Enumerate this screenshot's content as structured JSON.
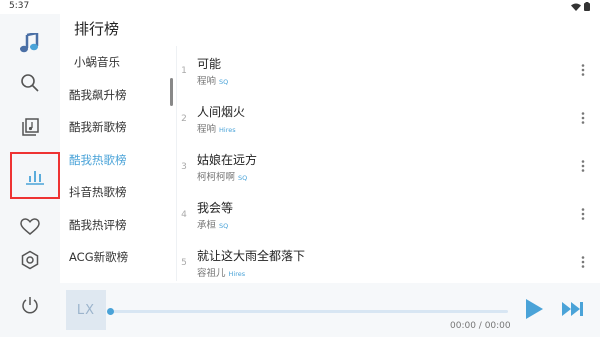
{
  "status": {
    "time": "5:37",
    "icons": [
      "wifi-icon",
      "battery-icon"
    ]
  },
  "nav": {
    "items": [
      {
        "name": "music-note-logo-icon"
      },
      {
        "name": "search-icon"
      },
      {
        "name": "song-list-icon"
      },
      {
        "name": "leaderboard-icon",
        "active": true
      },
      {
        "name": "heart-icon"
      },
      {
        "name": "settings-hexagon-icon"
      },
      {
        "name": "power-icon"
      }
    ]
  },
  "page": {
    "title": "排行榜"
  },
  "boards": {
    "items": [
      "小蜗音乐",
      "酷我飙升榜",
      "酷我新歌榜",
      "酷我热歌榜",
      "抖音热歌榜",
      "酷我热评榜",
      "ACG新歌榜"
    ],
    "selected_index": 3
  },
  "songs": [
    {
      "num": "1",
      "title": "可能",
      "artist": "程响",
      "badge": "SQ"
    },
    {
      "num": "2",
      "title": "人间烟火",
      "artist": "程响",
      "badge": "Hires"
    },
    {
      "num": "3",
      "title": "姑娘在远方",
      "artist": "柯柯柯啊",
      "badge": "SQ"
    },
    {
      "num": "4",
      "title": "我会等",
      "artist": "承桓",
      "badge": "SQ"
    },
    {
      "num": "5",
      "title": "就让这大雨全都落下",
      "artist": "容祖儿",
      "badge": "Hires"
    }
  ],
  "player": {
    "cover_text": "LX",
    "time": "00:00 / 00:00",
    "progress": 0
  },
  "colors": {
    "accent": "#4aa3d8",
    "highlight_box": "#e33333"
  }
}
